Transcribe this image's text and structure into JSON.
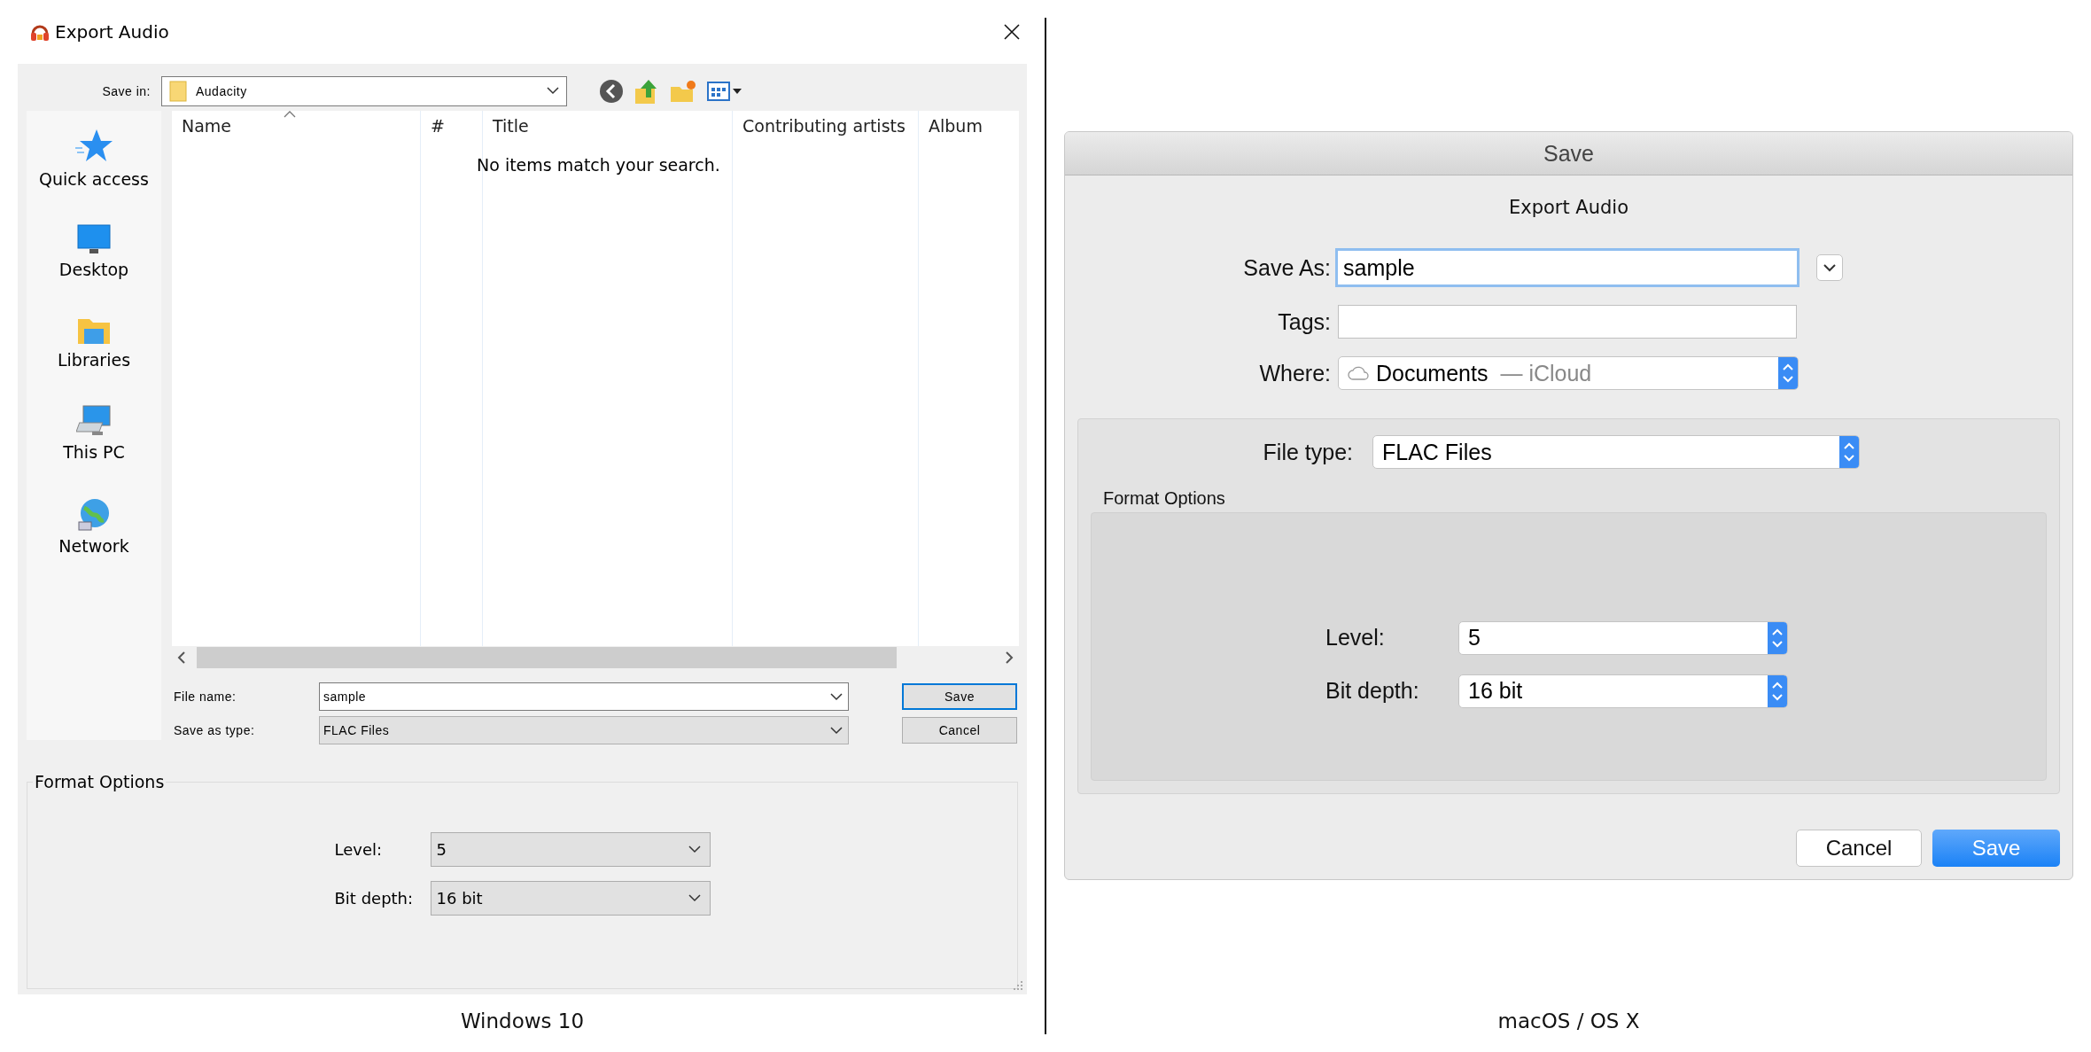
{
  "windows_dialog": {
    "title": "Export Audio",
    "save_in": {
      "label": "Save in:",
      "value": "Audacity"
    },
    "places": [
      {
        "kind": "star",
        "label": "Quick access"
      },
      {
        "kind": "desktop",
        "label": "Desktop"
      },
      {
        "kind": "libraries",
        "label": "Libraries"
      },
      {
        "kind": "computer",
        "label": "This PC"
      },
      {
        "kind": "network",
        "label": "Network"
      }
    ],
    "file_list": {
      "columns": [
        "Name",
        "#",
        "Title",
        "Contributing artists",
        "Album"
      ],
      "empty_message": "No items match your search."
    },
    "fields": [
      {
        "label": "File name:",
        "value": "sample",
        "editable": true
      },
      {
        "label": "Save as type:",
        "value": "FLAC Files",
        "editable": false
      }
    ],
    "buttons": [
      {
        "label": "Save",
        "default": true
      },
      {
        "label": "Cancel",
        "default": false
      }
    ],
    "format_options": {
      "title": "Format Options",
      "fields": [
        {
          "label": "Level:",
          "value": "5"
        },
        {
          "label": "Bit depth:",
          "value": "16 bit"
        }
      ]
    },
    "caption": "Windows 10"
  },
  "mac_dialog": {
    "window_title": "Save",
    "heading": "Export Audio",
    "save_as": {
      "label": "Save As:",
      "value": "sample"
    },
    "tags": {
      "label": "Tags:"
    },
    "where": {
      "label": "Where:",
      "value": "Documents",
      "location": "— iCloud"
    },
    "file_type": {
      "label": "File type:",
      "value": "FLAC Files"
    },
    "format_options": {
      "title": "Format Options",
      "fields": [
        {
          "label": "Level:",
          "value": "5"
        },
        {
          "label": "Bit depth:",
          "value": "16 bit"
        }
      ]
    },
    "buttons": [
      {
        "label": "Cancel",
        "default": false
      },
      {
        "label": "Save",
        "default": true
      }
    ],
    "caption": "macOS / OS X"
  }
}
